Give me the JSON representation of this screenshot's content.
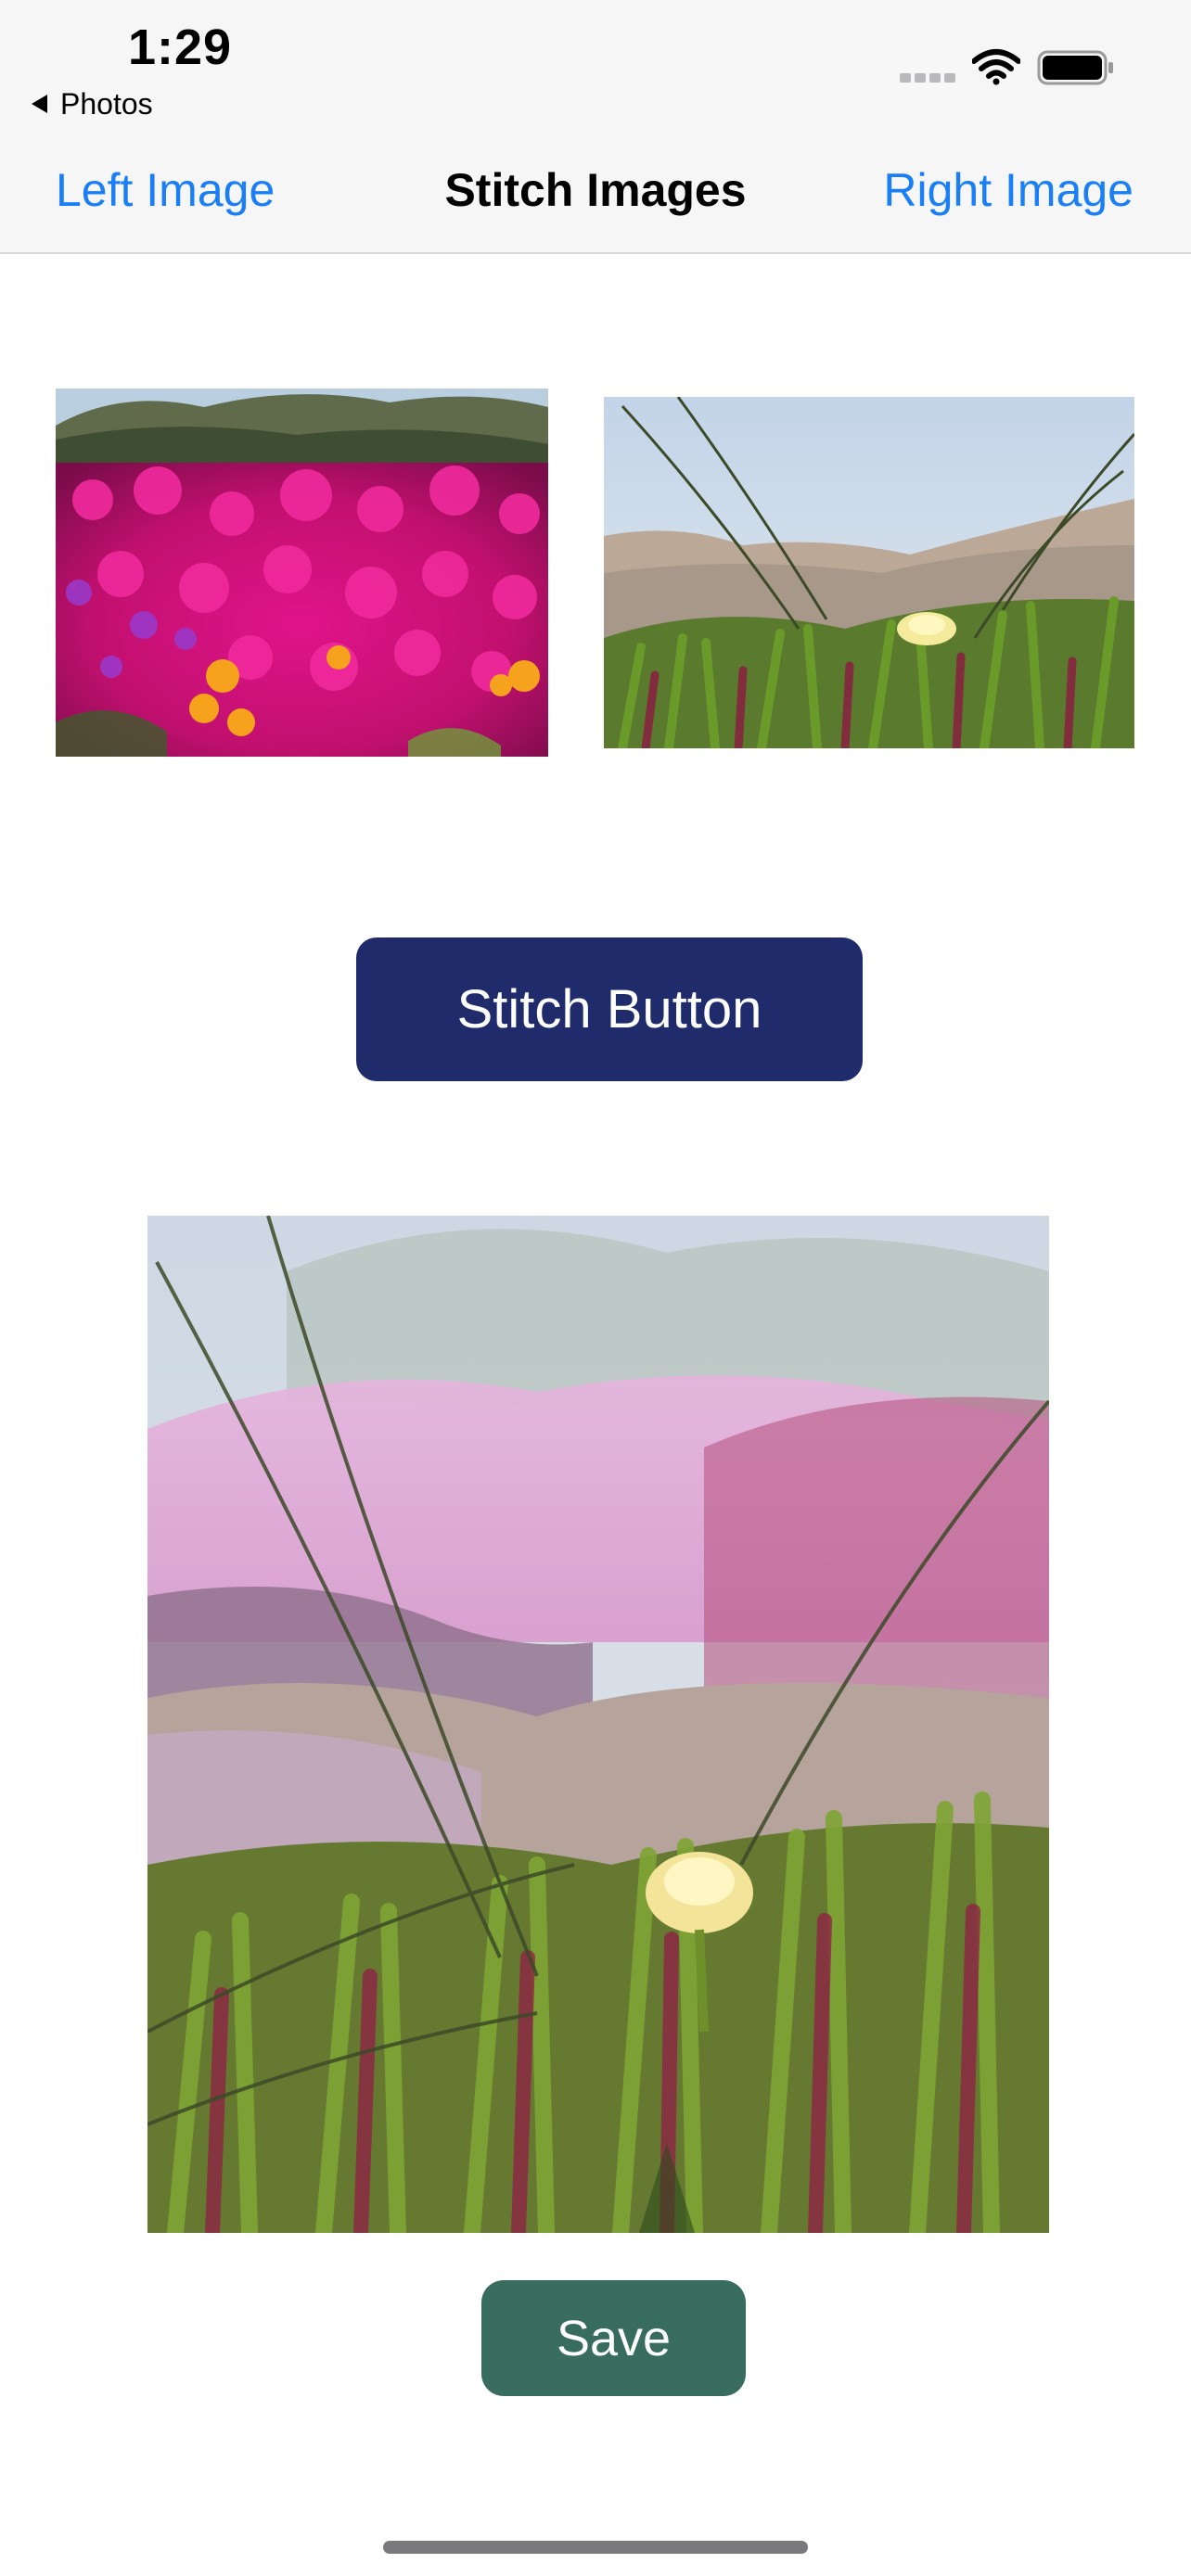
{
  "status_bar": {
    "time": "1:29",
    "back_app": "Photos",
    "signal_icon": "cellular-signal-icon",
    "wifi_icon": "wifi-icon",
    "battery_icon": "battery-icon"
  },
  "nav": {
    "left_label": "Left Image",
    "title": "Stitch Images",
    "right_label": "Right Image",
    "accent_color": "#1a7ff6"
  },
  "images": {
    "left": "ice plant flowers photo",
    "right": "dune grass flower photo",
    "stitched": "stitched blended photo"
  },
  "buttons": {
    "stitch_label": "Stitch Button",
    "stitch_color": "#1f2b6b",
    "save_label": "Save",
    "save_color": "#386c5f"
  }
}
